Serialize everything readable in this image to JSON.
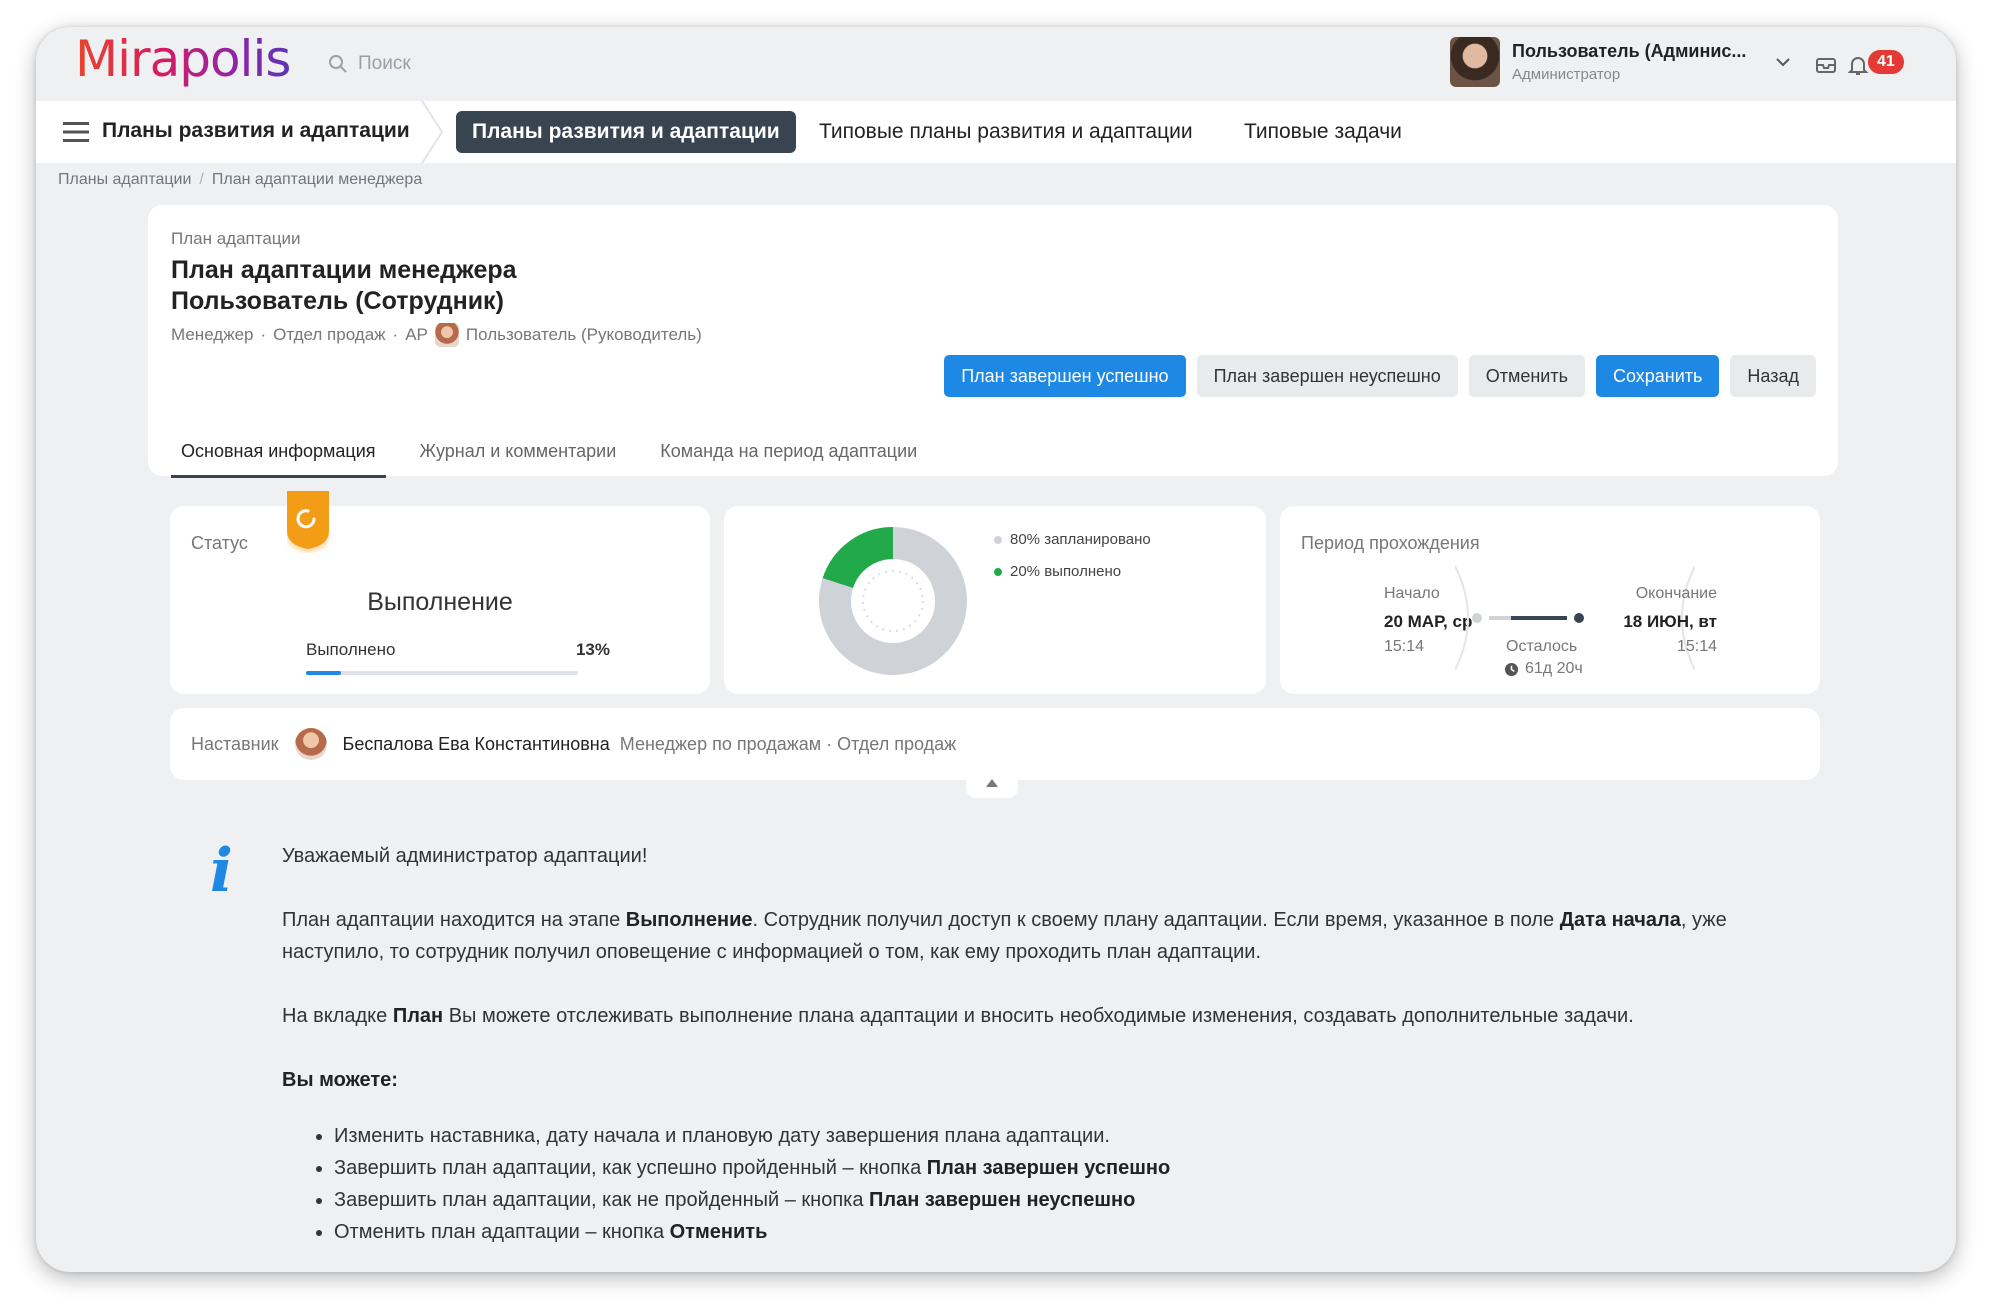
{
  "app": {
    "logo": "Mirapolis",
    "search_placeholder": "Поиск"
  },
  "user": {
    "name": "Пользователь (Админис...",
    "role": "Администратор",
    "notifications": "41"
  },
  "nav": {
    "title": "Планы развития и адаптации",
    "tabs": [
      "Планы развития и адаптации",
      "Типовые планы развития и адаптации",
      "Типовые задачи"
    ],
    "active_tab": 0
  },
  "breadcrumb": [
    "Планы адаптации",
    "План адаптации менеджера"
  ],
  "plan": {
    "kicker": "План адаптации",
    "title_line1": "План адаптации менеджера",
    "title_line2": "Пользователь (Сотрудник)",
    "meta_position": "Менеджер",
    "meta_department": "Отдел продаж",
    "meta_code": "АР",
    "meta_manager": "Пользователь (Руководитель)"
  },
  "buttons": {
    "success": "План завершен успешно",
    "fail": "План завершен неуспешно",
    "cancel": "Отменить",
    "save": "Сохранить",
    "back": "Назад"
  },
  "tabs": [
    "Основная информация",
    "Журнал и комментарии",
    "Команда на период адаптации"
  ],
  "status": {
    "label": "Статус",
    "value": "Выполнение",
    "progress_label": "Выполнено",
    "progress_text": "13%",
    "progress_fraction": 0.13
  },
  "chart_data": {
    "type": "pie",
    "categories": [
      "запланировано",
      "выполнено"
    ],
    "values": [
      80,
      20
    ],
    "labels": [
      "80% запланировано",
      "20% выполнено"
    ],
    "colors": [
      "#cfd3d8",
      "#22a94a"
    ]
  },
  "period": {
    "label": "Период прохождения",
    "start_label": "Начало",
    "start_date": "20 МАР, ср",
    "start_time": "15:14",
    "end_label": "Окончание",
    "end_date": "18 ИЮН, вт",
    "end_time": "15:14",
    "remaining_label": "Осталось",
    "remaining_value": "61д 20ч"
  },
  "mentor": {
    "label": "Наставник",
    "name": "Беспалова Ева Константиновна",
    "position": "Менеджер по продажам · Отдел продаж"
  },
  "info": {
    "greeting": "Уважаемый администратор адаптации!",
    "p1_a": "План адаптации находится на этапе ",
    "p1_b": "Выполнение",
    "p1_c": ". Сотрудник получил доступ к своему плану адаптации. Если время, указанное в поле ",
    "p1_d": "Дата начала",
    "p1_e": ", уже наступило, то сотрудник получил оповещение с информацией о том, как ему проходить план адаптации.",
    "p2_a": "На вкладке ",
    "p2_b": "План",
    "p2_c": " Вы можете отслеживать выполнение плана адаптации и вносить необходимые изменения, создавать дополнительные задачи.",
    "can_title": "Вы можете:",
    "li1": "Изменить наставника, дату начала и плановую дату завершения плана адаптации.",
    "li2_a": "Завершить план адаптации, как успешно пройденный – кнопка ",
    "li2_b": "План завершен успешно",
    "li3_a": "Завершить план адаптации, как не пройденный – кнопка ",
    "li3_b": "План завершен неуспешно",
    "li4_a": "Отменить план адаптации – кнопка ",
    "li4_b": "Отменить"
  }
}
